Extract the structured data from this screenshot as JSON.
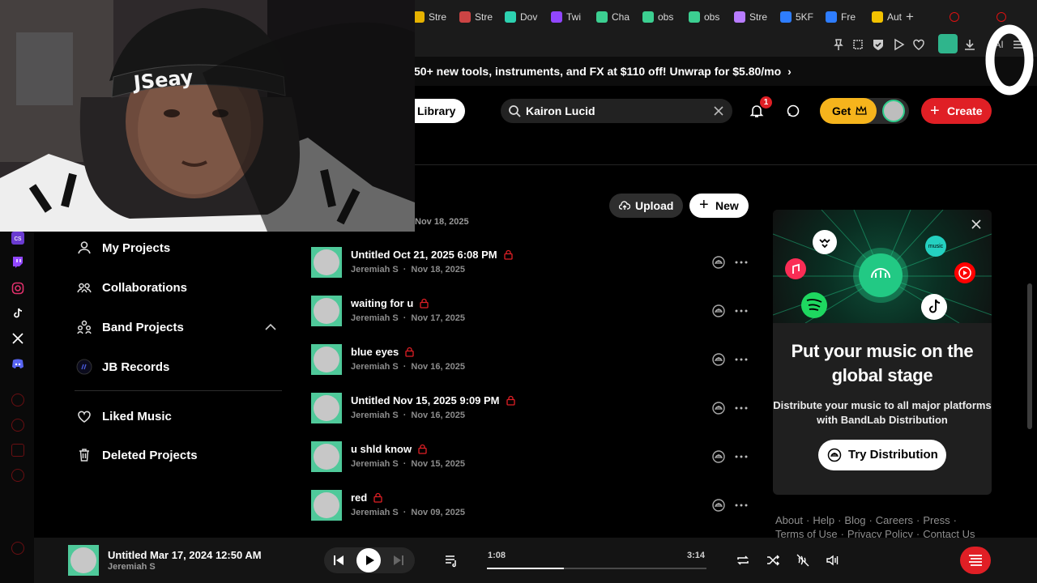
{
  "browser": {
    "tabs": [
      {
        "label": "Stre",
        "icon": "star-icon",
        "color": "#e6b200"
      },
      {
        "label": "Stre",
        "icon": "game-icon",
        "color": "#c44"
      },
      {
        "label": "Dov",
        "icon": "link-icon",
        "color": "#2dd1b0"
      },
      {
        "label": "Twi",
        "icon": "twitch-icon",
        "color": "#9146ff"
      },
      {
        "label": "Cha",
        "icon": "obs-icon",
        "color": "#3ccf91"
      },
      {
        "label": "obs",
        "icon": "obs-icon",
        "color": "#3ccf91"
      },
      {
        "label": "obs",
        "icon": "obs-icon",
        "color": "#3ccf91"
      },
      {
        "label": "Stre",
        "icon": "vite-icon",
        "color": "#b87cff"
      },
      {
        "label": "5KF",
        "icon": "gaming-icon",
        "color": "#2e7dff"
      },
      {
        "label": "Fre",
        "icon": "gaming-icon",
        "color": "#2e7dff"
      },
      {
        "label": "Aut",
        "icon": "note-icon",
        "color": "#f2c200"
      }
    ],
    "new_tab_symbol": "+",
    "toolbar_ai_label": "AI"
  },
  "promo": {
    "text": "50+ new tools, instruments, and FX at $110 off! Unwrap for $5.80/mo",
    "chevron": "›"
  },
  "header": {
    "library_label": "Library",
    "search_value": "Kairon Lucid",
    "notification_count": "1",
    "get_label": "Get",
    "create_label": "Create"
  },
  "sidebar": {
    "items": [
      {
        "label": "My Projects",
        "icon": "user-icon"
      },
      {
        "label": "Collaborations",
        "icon": "users-icon"
      },
      {
        "label": "Band Projects",
        "icon": "band-icon",
        "expanded": true
      },
      {
        "label": "JB Records",
        "icon": "band-avatar-icon"
      },
      {
        "label": "Liked Music",
        "icon": "heart-icon"
      },
      {
        "label": "Deleted Projects",
        "icon": "trash-icon"
      }
    ]
  },
  "main": {
    "upload_label": "Upload",
    "new_label": "New",
    "partial_date": "Nov 18, 2025",
    "projects": [
      {
        "title": "Untitled Oct 21, 2025 6:08 PM",
        "author": "Jeremiah S",
        "date": "Nov 18, 2025"
      },
      {
        "title": "waiting for u",
        "author": "Jeremiah S",
        "date": "Nov 17, 2025"
      },
      {
        "title": "blue eyes",
        "author": "Jeremiah S",
        "date": "Nov 16, 2025"
      },
      {
        "title": "Untitled Nov 15, 2025 9:09 PM",
        "author": "Jeremiah S",
        "date": "Nov 16, 2025"
      },
      {
        "title": "u shld know",
        "author": "Jeremiah S",
        "date": "Nov 15, 2025"
      },
      {
        "title": "red",
        "author": "Jeremiah S",
        "date": "Nov 09, 2025"
      }
    ],
    "meta_separator": "·"
  },
  "distribution": {
    "title": "Put your music on the global stage",
    "body": "Distribute your music to all major platforms with BandLab Distribution",
    "button_label": "Try Distribution"
  },
  "footer": {
    "links": [
      "About",
      "Help",
      "Blog",
      "Careers",
      "Press",
      "Terms of Use",
      "Privacy Policy",
      "Contact Us"
    ],
    "separator": "·"
  },
  "player": {
    "title": "Untitled Mar 17, 2024 12:50 AM",
    "artist": "Jeremiah S",
    "elapsed": "1:08",
    "duration": "3:14",
    "progress_fraction": 0.35
  },
  "webcam": {
    "hat_text": "JSeay"
  },
  "colors": {
    "accent_red": "#e01f25",
    "get_yellow": "#f6b41c",
    "thumb_green": "#4fc99a"
  }
}
